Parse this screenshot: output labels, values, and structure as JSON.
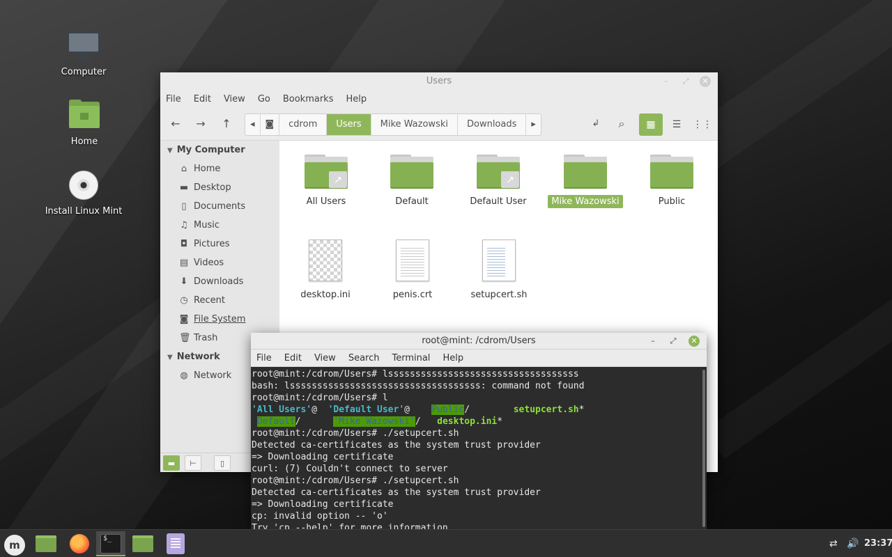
{
  "desktop": {
    "icons": [
      {
        "label": "Computer"
      },
      {
        "label": "Home"
      },
      {
        "label": "Install Linux Mint"
      }
    ]
  },
  "file_manager": {
    "title": "Users",
    "menu": [
      "File",
      "Edit",
      "View",
      "Go",
      "Bookmarks",
      "Help"
    ],
    "path": [
      "cdrom",
      "Users",
      "Mike Wazowski",
      "Downloads"
    ],
    "active_crumb": "Users",
    "sidebar": {
      "sections": [
        {
          "title": "My Computer",
          "items": [
            "Home",
            "Desktop",
            "Documents",
            "Music",
            "Pictures",
            "Videos",
            "Downloads",
            "Recent",
            "File System",
            "Trash"
          ]
        },
        {
          "title": "Network",
          "items": [
            "Network"
          ]
        }
      ],
      "current": "File System"
    },
    "items": [
      {
        "name": "All Users",
        "kind": "folder-link"
      },
      {
        "name": "Default",
        "kind": "folder"
      },
      {
        "name": "Default User",
        "kind": "folder-link"
      },
      {
        "name": "Mike Wazowski",
        "kind": "folder",
        "selected": true
      },
      {
        "name": "Public",
        "kind": "folder"
      },
      {
        "name": "desktop.ini",
        "kind": "ini-file"
      },
      {
        "name": "penis.crt",
        "kind": "text-file"
      },
      {
        "name": "setupcert.sh",
        "kind": "script-file"
      }
    ]
  },
  "terminal": {
    "title": "root@mint: /cdrom/Users",
    "menu": [
      "File",
      "Edit",
      "View",
      "Search",
      "Terminal",
      "Help"
    ],
    "lines": [
      "root@mint:/cdrom/Users# lsssssssssssssssssssssssssssssssssss",
      "bash: lsssssssssssssssssssssssssssssssssss: command not found",
      "root@mint:/cdrom/Users# l",
      "root@mint:/cdrom/Users# ./setupcert.sh",
      "Detected ca-certificates as the system trust provider",
      "=> Downloading certificate",
      "curl: (7) Couldn't connect to server",
      "root@mint:/cdrom/Users# ./setupcert.sh",
      "Detected ca-certificates as the system trust provider",
      "=> Downloading certificate",
      "cp: invalid option -- 'o'",
      "Try 'cp --help' for more information."
    ],
    "ls_row1": [
      "'All Users'",
      "@",
      "'Default User'",
      "@",
      "Public",
      "/",
      "setupcert.sh",
      "*"
    ],
    "ls_row2": [
      "Default",
      "/",
      "'Mike Wazowski'",
      "/",
      "desktop.ini",
      "*"
    ]
  },
  "panel": {
    "clock": "23:37",
    "launchers": [
      "menu-button",
      "show-desktop",
      "firefox",
      "terminal",
      "files",
      "text-editor"
    ]
  }
}
